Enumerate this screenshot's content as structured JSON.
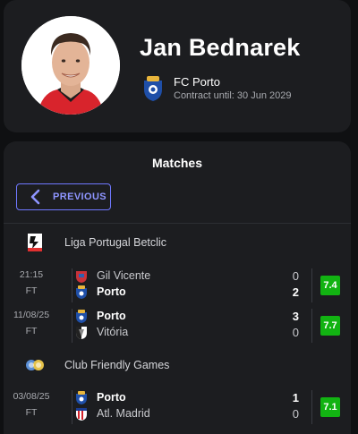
{
  "player": {
    "name": "Jan Bednarek",
    "club": "FC Porto",
    "contract": "Contract until: 30 Jun 2029"
  },
  "matches": {
    "title": "Matches",
    "previous_label": "PREVIOUS",
    "leagues": [
      {
        "name": "Liga Portugal Betclic",
        "icon": "liga-portugal-icon",
        "games": [
          {
            "date": "21:15",
            "status": "FT",
            "home": {
              "name": "Gil Vicente",
              "score": "0",
              "crest": "gil-vicente-crest-icon",
              "win": false
            },
            "away": {
              "name": "Porto",
              "score": "2",
              "crest": "porto-crest-icon",
              "win": true
            },
            "rating": "7.4"
          },
          {
            "date": "11/08/25",
            "status": "FT",
            "home": {
              "name": "Porto",
              "score": "3",
              "crest": "porto-crest-icon",
              "win": true
            },
            "away": {
              "name": "Vitória",
              "score": "0",
              "crest": "vitoria-crest-icon",
              "win": false
            },
            "rating": "7.7"
          }
        ]
      },
      {
        "name": "Club Friendly Games",
        "icon": "club-friendly-icon",
        "games": [
          {
            "date": "03/08/25",
            "status": "FT",
            "home": {
              "name": "Porto",
              "score": "1",
              "crest": "porto-crest-icon",
              "win": true
            },
            "away": {
              "name": "Atl. Madrid",
              "score": "0",
              "crest": "atletico-madrid-crest-icon",
              "win": false
            },
            "rating": "7.1"
          }
        ]
      }
    ]
  },
  "colors": {
    "background": "#0f1012",
    "card": "#1c1d20",
    "accent": "#6f78ff",
    "rating_green": "#12b312"
  }
}
